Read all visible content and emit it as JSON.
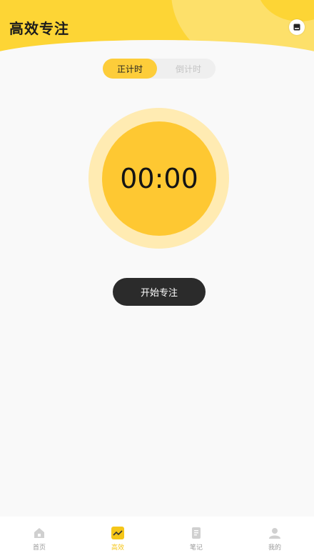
{
  "header": {
    "title": "高效专注"
  },
  "mode_switch": {
    "options": [
      "正计时",
      "倒计时"
    ],
    "selected": "正计时"
  },
  "timer": {
    "display": "00:00"
  },
  "actions": {
    "start_label": "开始专注"
  },
  "tabbar": {
    "items": [
      {
        "label": "首页",
        "icon": "home-icon",
        "active": false
      },
      {
        "label": "高效",
        "icon": "chart-icon",
        "active": true
      },
      {
        "label": "笔记",
        "icon": "note-icon",
        "active": false
      },
      {
        "label": "我的",
        "icon": "user-icon",
        "active": false
      }
    ]
  },
  "colors": {
    "accent": "#fdd535",
    "timer_fill": "#fec832",
    "timer_halo": "#ffebb2",
    "button_dark": "#2b2b2b"
  }
}
